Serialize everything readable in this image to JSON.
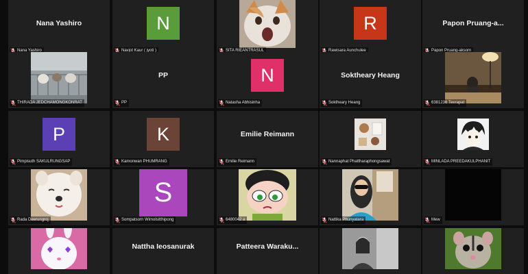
{
  "meeting": {
    "participants": [
      {
        "name": "Nana Yashiro",
        "display": "Nana Yashiro",
        "type": "name"
      },
      {
        "name": "Navjot Kaur ( jyoti )",
        "type": "avatar",
        "letter": "N",
        "color": "#5b9c3a"
      },
      {
        "name": "SITA RIEANTRASUL",
        "type": "photo",
        "photo": "cat-screaming"
      },
      {
        "name": "Rawisara Aunchulee",
        "type": "avatar",
        "letter": "R",
        "color": "#c8361a"
      },
      {
        "name": "Papon Pruang-aksorn",
        "display": "Papon  Pruang-a...",
        "type": "name"
      },
      {
        "name": "THIRADA JEDCHAMONGKONRAT",
        "type": "photo",
        "photo": "cats-balcony"
      },
      {
        "name": "PP",
        "display": "PP",
        "type": "name"
      },
      {
        "name": "Natasha Abhisinha",
        "type": "avatar",
        "letter": "N",
        "color": "#e0306a"
      },
      {
        "name": "Soktheary Heang",
        "display": "Soktheary Heang",
        "type": "name"
      },
      {
        "name": "6381236 Teerapat",
        "type": "photo",
        "photo": "room-lamp"
      },
      {
        "name": "Pimpisuth SAKULRUNGSAP",
        "type": "avatar",
        "letter": "P",
        "color": "#5a3fb5"
      },
      {
        "name": "Kamonwan PHUMRANG",
        "type": "avatar",
        "letter": "K",
        "color": "#6b4437"
      },
      {
        "name": "Emilie Reimann",
        "display": "Emilie Reimann",
        "type": "name"
      },
      {
        "name": "Nannaphat Phattharaphongsawat",
        "type": "photo",
        "photo": "flatlay"
      },
      {
        "name": "MINLADA PREEDAKULPHANIT",
        "type": "photo",
        "photo": "anime"
      },
      {
        "name": "Rada Deerungroj",
        "type": "photo",
        "photo": "dog"
      },
      {
        "name": "Sompatsorn Wimolsitthipong",
        "type": "avatar-big",
        "letter": "S",
        "color": "#ab47bc"
      },
      {
        "name": "6480042 a",
        "type": "photo",
        "photo": "cartoon-girl"
      },
      {
        "name": "Nattika Phunyatara",
        "type": "photo",
        "photo": "selfie"
      },
      {
        "name": "Mew",
        "type": "photo",
        "photo": "black"
      },
      {
        "name": "",
        "type": "photo",
        "photo": "bunny"
      },
      {
        "name": "",
        "display": "Nattha  Ieosanurak",
        "type": "name"
      },
      {
        "name": "",
        "display": "Patteera  Waraku...",
        "type": "name"
      },
      {
        "name": "",
        "type": "photo",
        "photo": "bw-person"
      },
      {
        "name": "",
        "type": "photo",
        "photo": "sugar-glider"
      }
    ]
  },
  "colors": {
    "tile_bg": "#202020",
    "grid_bg": "#0c0c0c",
    "mic_muted": "#e23b3b"
  }
}
